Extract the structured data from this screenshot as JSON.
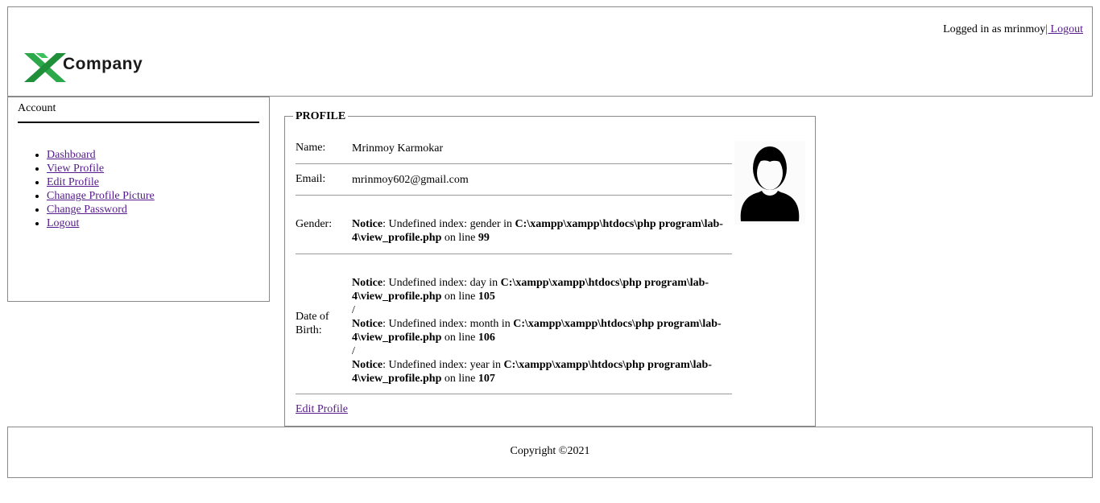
{
  "header": {
    "logo_text": "Company",
    "logged_in_as": "Logged in as mrinmoy",
    "logout_label": "| Logout"
  },
  "sidebar": {
    "title": "Account",
    "items": [
      {
        "label": "Dashboard"
      },
      {
        "label": "View Profile"
      },
      {
        "label": "Edit Profile"
      },
      {
        "label": "Chanage Profile Picture"
      },
      {
        "label": "Change Password"
      },
      {
        "label": "Logout"
      }
    ]
  },
  "profile": {
    "legend": "PROFILE",
    "name_label": "Name:",
    "name_value": "Mrinmoy Karmokar",
    "email_label": "Email:",
    "email_value": "mrinmoy602@gmail.com",
    "gender_label": "Gender:",
    "dob_label_1": "Date of",
    "dob_label_2": "Birth:",
    "separator": "/",
    "notices": {
      "word": "Notice",
      "gender": {
        "text": ": Undefined index: gender in ",
        "file": "C:\\xampp\\xampp\\htdocs\\php program\\lab-4\\view_profile.php",
        "on_line": " on line ",
        "line": "99"
      },
      "day": {
        "text": ": Undefined index: day in ",
        "file": "C:\\xampp\\xampp\\htdocs\\php program\\lab-4\\view_profile.php",
        "on_line": " on line ",
        "line": "105"
      },
      "month": {
        "text": ": Undefined index: month in ",
        "file": "C:\\xampp\\xampp\\htdocs\\php program\\lab-4\\view_profile.php",
        "on_line": " on line ",
        "line": "106"
      },
      "year": {
        "text": ": Undefined index: year in ",
        "file": "C:\\xampp\\xampp\\htdocs\\php program\\lab-4\\view_profile.php",
        "on_line": " on line ",
        "line": "107"
      }
    },
    "edit_link": "Edit Profile",
    "avatar_icon": "user-silhouette-icon"
  },
  "footer": {
    "copyright": "Copyright ©2021"
  },
  "colors": {
    "link": "#551a8b",
    "logo_green": "#2aa84a",
    "border": "#8a8a8a"
  }
}
